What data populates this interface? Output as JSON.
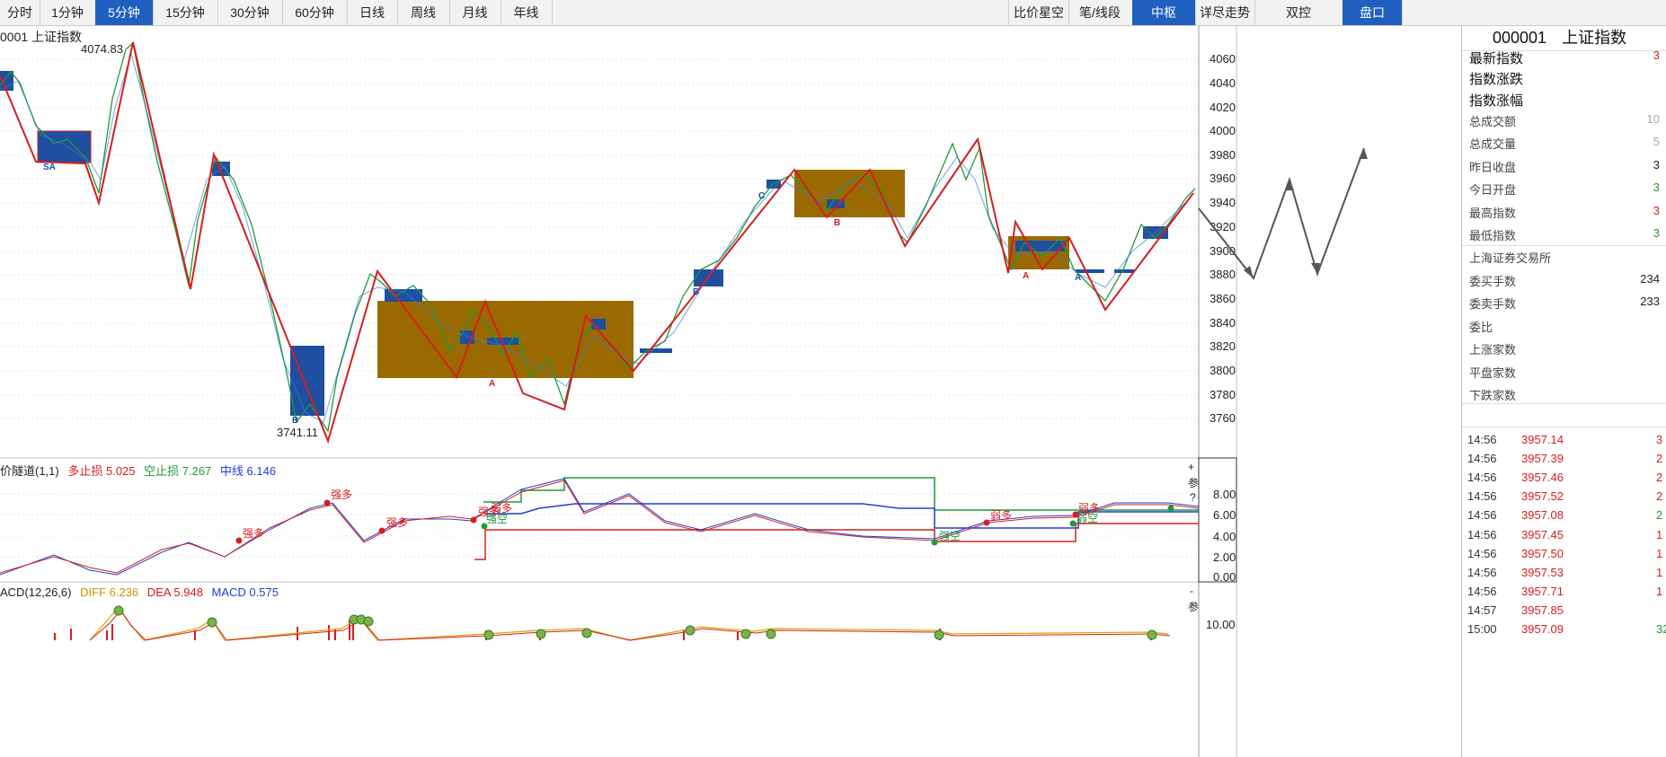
{
  "toolbar": {
    "left_tabs": [
      "分时",
      "1分钟",
      "5分钟",
      "15分钟",
      "30分钟",
      "60分钟",
      "日线",
      "周线",
      "月线",
      "年线"
    ],
    "active_left": "5分钟",
    "right_tabs": [
      "比价星空",
      "笔/线段",
      "中枢",
      "详尽走势",
      "双控",
      "盘口"
    ],
    "active_right": [
      "中枢",
      "盘口"
    ]
  },
  "main_chart": {
    "title": "0001 上证指数",
    "price_axis": [
      "4060",
      "4040",
      "4020",
      "4000",
      "3980",
      "3960",
      "3940",
      "3920",
      "3900",
      "3880",
      "3860",
      "3840",
      "3820",
      "3800",
      "3780",
      "3760"
    ],
    "high_label": "4074.83",
    "low_label": "3741.11",
    "marks": [
      "SA",
      "B",
      "C",
      "B",
      "B",
      "A",
      "A",
      "A"
    ]
  },
  "indicator1": {
    "name": "价隧道(1,1)",
    "long_stop_label": "多止损 5.025",
    "short_stop_label": "空止损 7.267",
    "mid_label": "中线 6.146",
    "axis": [
      "8.00",
      "6.00",
      "4.00",
      "2.00",
      "0.00"
    ],
    "tags": [
      "强多",
      "强多",
      "强多",
      "强多",
      "弱多",
      "强空",
      "强空",
      "弱多",
      "弱空",
      "弱多"
    ],
    "side_buttons": [
      "+",
      "参",
      "?"
    ]
  },
  "indicator2": {
    "name": "ACD(12,26,6)",
    "diff_label": "DIFF 6.236",
    "dea_label": "DEA 5.948",
    "macd_label": "MACD 0.575",
    "axis": [
      "10.00"
    ],
    "side_buttons": [
      "-",
      "参"
    ]
  },
  "quote_panel": {
    "code": "000001",
    "name": "上证指数",
    "big_rows": [
      "最新指数",
      "指数涨跌",
      "指数涨幅"
    ],
    "rows": [
      "总成交额",
      "总成交量",
      "昨日收盘",
      "今日开盘",
      "最高指数",
      "最低指数"
    ],
    "row_values": [
      "10",
      "5",
      "3",
      "3",
      "3",
      "3"
    ],
    "exchange": "上海证券交易所",
    "order_rows": [
      "委买手数",
      "委卖手数",
      "委比",
      "上涨家数",
      "平盘家数",
      "下跌家数"
    ],
    "order_values": [
      "234",
      "233",
      "",
      "",
      "",
      ""
    ],
    "big_values": [
      "3",
      "",
      ""
    ]
  },
  "ticks": [
    {
      "time": "14:56",
      "price": "3957.14",
      "vol": "3"
    },
    {
      "time": "14:56",
      "price": "3957.39",
      "vol": "2"
    },
    {
      "time": "14:56",
      "price": "3957.46",
      "vol": "2"
    },
    {
      "time": "14:56",
      "price": "3957.52",
      "vol": "2"
    },
    {
      "time": "14:56",
      "price": "3957.08",
      "vol": "2"
    },
    {
      "time": "14:56",
      "price": "3957.45",
      "vol": "1"
    },
    {
      "time": "14:56",
      "price": "3957.50",
      "vol": "1"
    },
    {
      "time": "14:56",
      "price": "3957.53",
      "vol": "1"
    },
    {
      "time": "14:56",
      "price": "3957.71",
      "vol": "1"
    },
    {
      "time": "14:57",
      "price": "3957.85",
      "vol": ""
    },
    {
      "time": "15:00",
      "price": "3957.09",
      "vol": "32"
    }
  ],
  "colors": {
    "accent": "#1f5fbf",
    "up": "#d51e1e",
    "down": "#1f9a3a",
    "box": "#a0720a",
    "zs_box": "#1e4fa0"
  }
}
